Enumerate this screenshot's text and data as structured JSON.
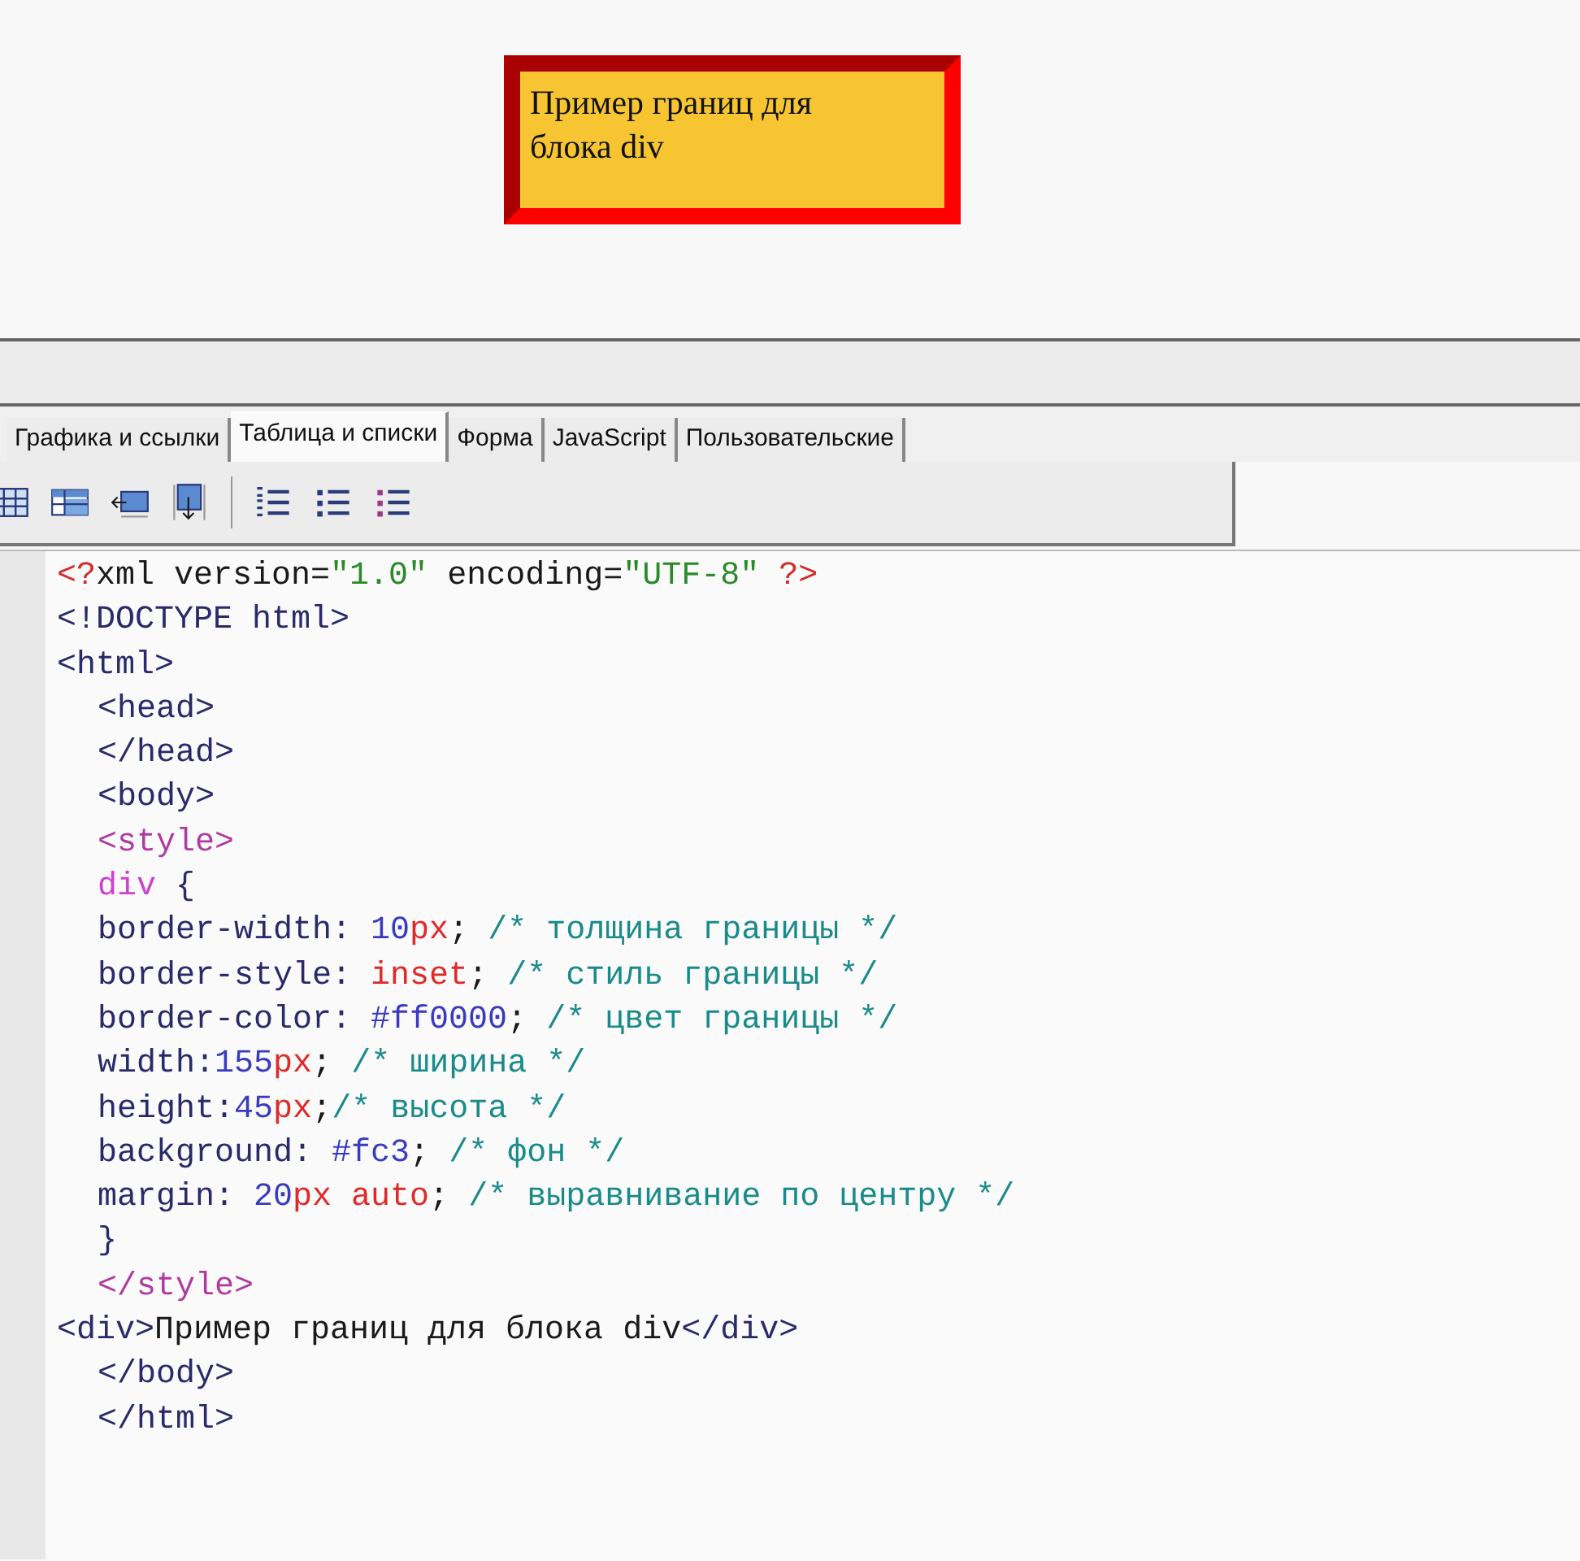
{
  "preview": {
    "text": "Пример границ для блока div"
  },
  "tabs": [
    {
      "label": "Графика и ссылки",
      "selected": false
    },
    {
      "label": "Таблица и списки",
      "selected": true
    },
    {
      "label": "Форма",
      "selected": false
    },
    {
      "label": "JavaScript",
      "selected": false
    },
    {
      "label": "Пользовательские",
      "selected": false
    }
  ],
  "code_lines": [
    {
      "indented": false,
      "tokens": [
        {
          "kind": "pi",
          "text": "<?"
        },
        {
          "kind": "plain",
          "text": "xml version="
        },
        {
          "kind": "str",
          "text": "\"1.0\""
        },
        {
          "kind": "plain",
          "text": " encoding="
        },
        {
          "kind": "str",
          "text": "\"UTF-8\""
        },
        {
          "kind": "pi",
          "text": " ?>"
        }
      ]
    },
    {
      "indented": false,
      "tokens": [
        {
          "kind": "tag",
          "text": "<!DOCTYPE html>"
        }
      ]
    },
    {
      "indented": false,
      "tokens": [
        {
          "kind": "tag",
          "text": "<html>"
        }
      ]
    },
    {
      "indented": true,
      "tokens": [
        {
          "kind": "tag",
          "text": "<head>"
        }
      ]
    },
    {
      "indented": true,
      "tokens": [
        {
          "kind": "tag",
          "text": "</head>"
        }
      ]
    },
    {
      "indented": true,
      "tokens": [
        {
          "kind": "tag",
          "text": "<body>"
        }
      ]
    },
    {
      "indented": true,
      "tokens": [
        {
          "kind": "style",
          "text": "<style>"
        }
      ]
    },
    {
      "indented": true,
      "tokens": [
        {
          "kind": "selector",
          "text": "div"
        },
        {
          "kind": "tag",
          "text": " {"
        }
      ]
    },
    {
      "indented": true,
      "tokens": [
        {
          "kind": "tag",
          "text": "border-width: "
        },
        {
          "kind": "num",
          "text": "10"
        },
        {
          "kind": "unit",
          "text": "px"
        },
        {
          "kind": "plain",
          "text": "; "
        },
        {
          "kind": "comment",
          "text": "/* толщина границы */"
        }
      ]
    },
    {
      "indented": true,
      "tokens": [
        {
          "kind": "tag",
          "text": "border-style: "
        },
        {
          "kind": "unit",
          "text": "inset"
        },
        {
          "kind": "plain",
          "text": "; "
        },
        {
          "kind": "comment",
          "text": "/* стиль границы */"
        }
      ]
    },
    {
      "indented": true,
      "tokens": [
        {
          "kind": "tag",
          "text": "border-color: "
        },
        {
          "kind": "num",
          "text": "#ff0000"
        },
        {
          "kind": "plain",
          "text": "; "
        },
        {
          "kind": "comment",
          "text": "/* цвет границы */"
        }
      ]
    },
    {
      "indented": true,
      "tokens": [
        {
          "kind": "tag",
          "text": "width:"
        },
        {
          "kind": "num",
          "text": "155"
        },
        {
          "kind": "unit",
          "text": "px"
        },
        {
          "kind": "plain",
          "text": "; "
        },
        {
          "kind": "comment",
          "text": "/* ширина */"
        }
      ]
    },
    {
      "indented": true,
      "tokens": [
        {
          "kind": "tag",
          "text": "height:"
        },
        {
          "kind": "num",
          "text": "45"
        },
        {
          "kind": "unit",
          "text": "px"
        },
        {
          "kind": "plain",
          "text": ";"
        },
        {
          "kind": "comment",
          "text": "/* высота */"
        }
      ]
    },
    {
      "indented": true,
      "tokens": [
        {
          "kind": "tag",
          "text": "background: "
        },
        {
          "kind": "num",
          "text": "#fc3"
        },
        {
          "kind": "plain",
          "text": "; "
        },
        {
          "kind": "comment",
          "text": "/* фон */"
        }
      ]
    },
    {
      "indented": true,
      "tokens": [
        {
          "kind": "tag",
          "text": "margin: "
        },
        {
          "kind": "num",
          "text": "20"
        },
        {
          "kind": "unit",
          "text": "px auto"
        },
        {
          "kind": "plain",
          "text": "; "
        },
        {
          "kind": "comment",
          "text": "/* выравнивание по центру */"
        }
      ]
    },
    {
      "indented": true,
      "tokens": [
        {
          "kind": "tag",
          "text": "}"
        }
      ]
    },
    {
      "indented": true,
      "tokens": [
        {
          "kind": "style",
          "text": "</style>"
        }
      ]
    },
    {
      "indented": false,
      "tokens": [
        {
          "kind": "tag",
          "text": "<div>"
        },
        {
          "kind": "plain",
          "text": "Пример границ для блока div"
        },
        {
          "kind": "tag",
          "text": "</div>"
        }
      ]
    },
    {
      "indented": true,
      "tokens": [
        {
          "kind": "tag",
          "text": "</body>"
        }
      ]
    },
    {
      "indented": true,
      "tokens": [
        {
          "kind": "tag",
          "text": "</html>"
        }
      ]
    }
  ]
}
